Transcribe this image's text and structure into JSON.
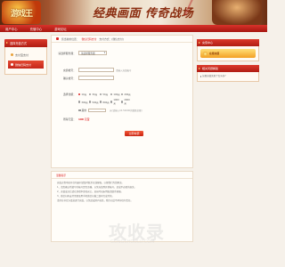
{
  "banner": {
    "logo_text": "游戏王",
    "slogan": "经典画面 传奇战场"
  },
  "nav": {
    "items": [
      "用户中心",
      "充值中心",
      "游戏论坛"
    ]
  },
  "sidebar": {
    "title": "选择充值方式",
    "items": [
      {
        "label": "支付宝支付",
        "active": false
      },
      {
        "label": "微信扫码支付",
        "active": true
      }
    ]
  },
  "breadcrumb": {
    "prefix": "您当前的位置：",
    "current": "微信扫码支付",
    "suffix": "支付方式：[微信支付]"
  },
  "form": {
    "server_label": "请选择服务器：",
    "server_value": "请选择服务器",
    "account_label": "充值帐号：",
    "confirm_label": "确认帐号：",
    "account_note": "请输入充值帐号",
    "amount_label": "选择金额：",
    "amounts": [
      "10元",
      "30元",
      "50元",
      "100元",
      "200元",
      "300元",
      "500元",
      "800元",
      "1000元",
      "2000元"
    ],
    "selected_index": 0,
    "other_label": "其他",
    "other_note": "元(请输入10-50000的整数金额)",
    "result_label": "所得元宝：",
    "result_value": "100 元宝",
    "submit_label": "立即充值"
  },
  "tips": {
    "title": "温馨提示",
    "lines": [
      "充值过程中如有任何疑问请及时联系在线客服，以便我们为您解决。",
      "1、请您确认所填写的帐号是否正确，以免充值到其他帐号，造成不必要的损失。",
      "2、充值成功后请在游戏中查收元宝，如长时间未到账请联系客服。",
      "3、微信扫码支付需要使用手机微信扫描二维码完成付款。",
      "请勿在非官方渠道进行充值，以免造成财产损失，我们对此不承担任何责任。"
    ]
  },
  "right": {
    "title": "充值中心",
    "badge": "在线充值",
    "section_title": "相关问题解答",
    "links": [
      "如果充值失败了怎么办?"
    ]
  },
  "watermark": {
    "text": "攻收录",
    "sub": "GONGSHOULU.COM"
  },
  "colors": {
    "accent": "#c8210f",
    "bg": "#f6f1ea"
  }
}
